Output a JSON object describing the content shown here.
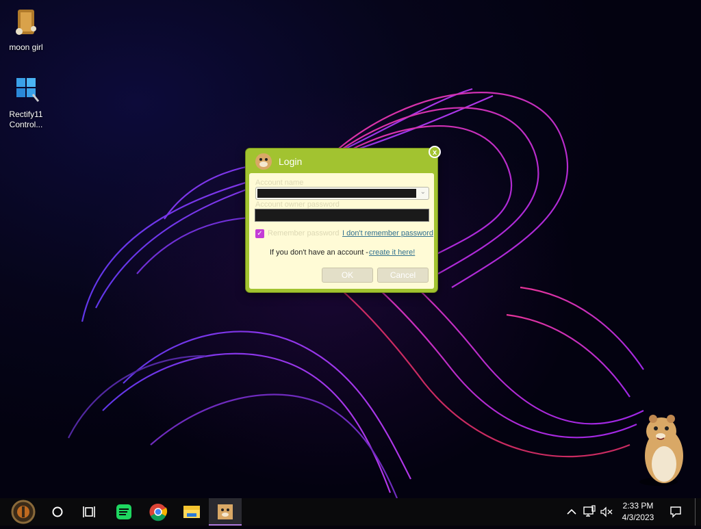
{
  "desktop": {
    "icons": [
      {
        "label": "moon girl",
        "icon": "bag-icon"
      },
      {
        "label_line1": "Rectify11",
        "label_line2": "Control...",
        "icon": "windows-logo-icon"
      }
    ]
  },
  "login_dialog": {
    "title": "Login",
    "close_label": "x",
    "account_name_label": "Account name",
    "password_label": "Account owner password",
    "remember_label": "Remember password",
    "remember_checked": true,
    "forgot_link": "I don't remember password",
    "no_account_text": "If you don't have an account - ",
    "create_link": "create it here!",
    "ok_label": "OK",
    "cancel_label": "Cancel",
    "accent_color": "#a2c330"
  },
  "taskbar": {
    "apps": [
      "start-orb-icon",
      "cortana-icon",
      "task-view-icon",
      "spotify-icon",
      "chrome-icon",
      "file-explorer-icon",
      "hamster-app-icon"
    ],
    "tray": [
      "chevron-up-icon",
      "network-icon",
      "volume-muted-icon"
    ],
    "time": "2:33 PM",
    "date": "4/3/2023",
    "notification_icon": "action-center-icon"
  }
}
